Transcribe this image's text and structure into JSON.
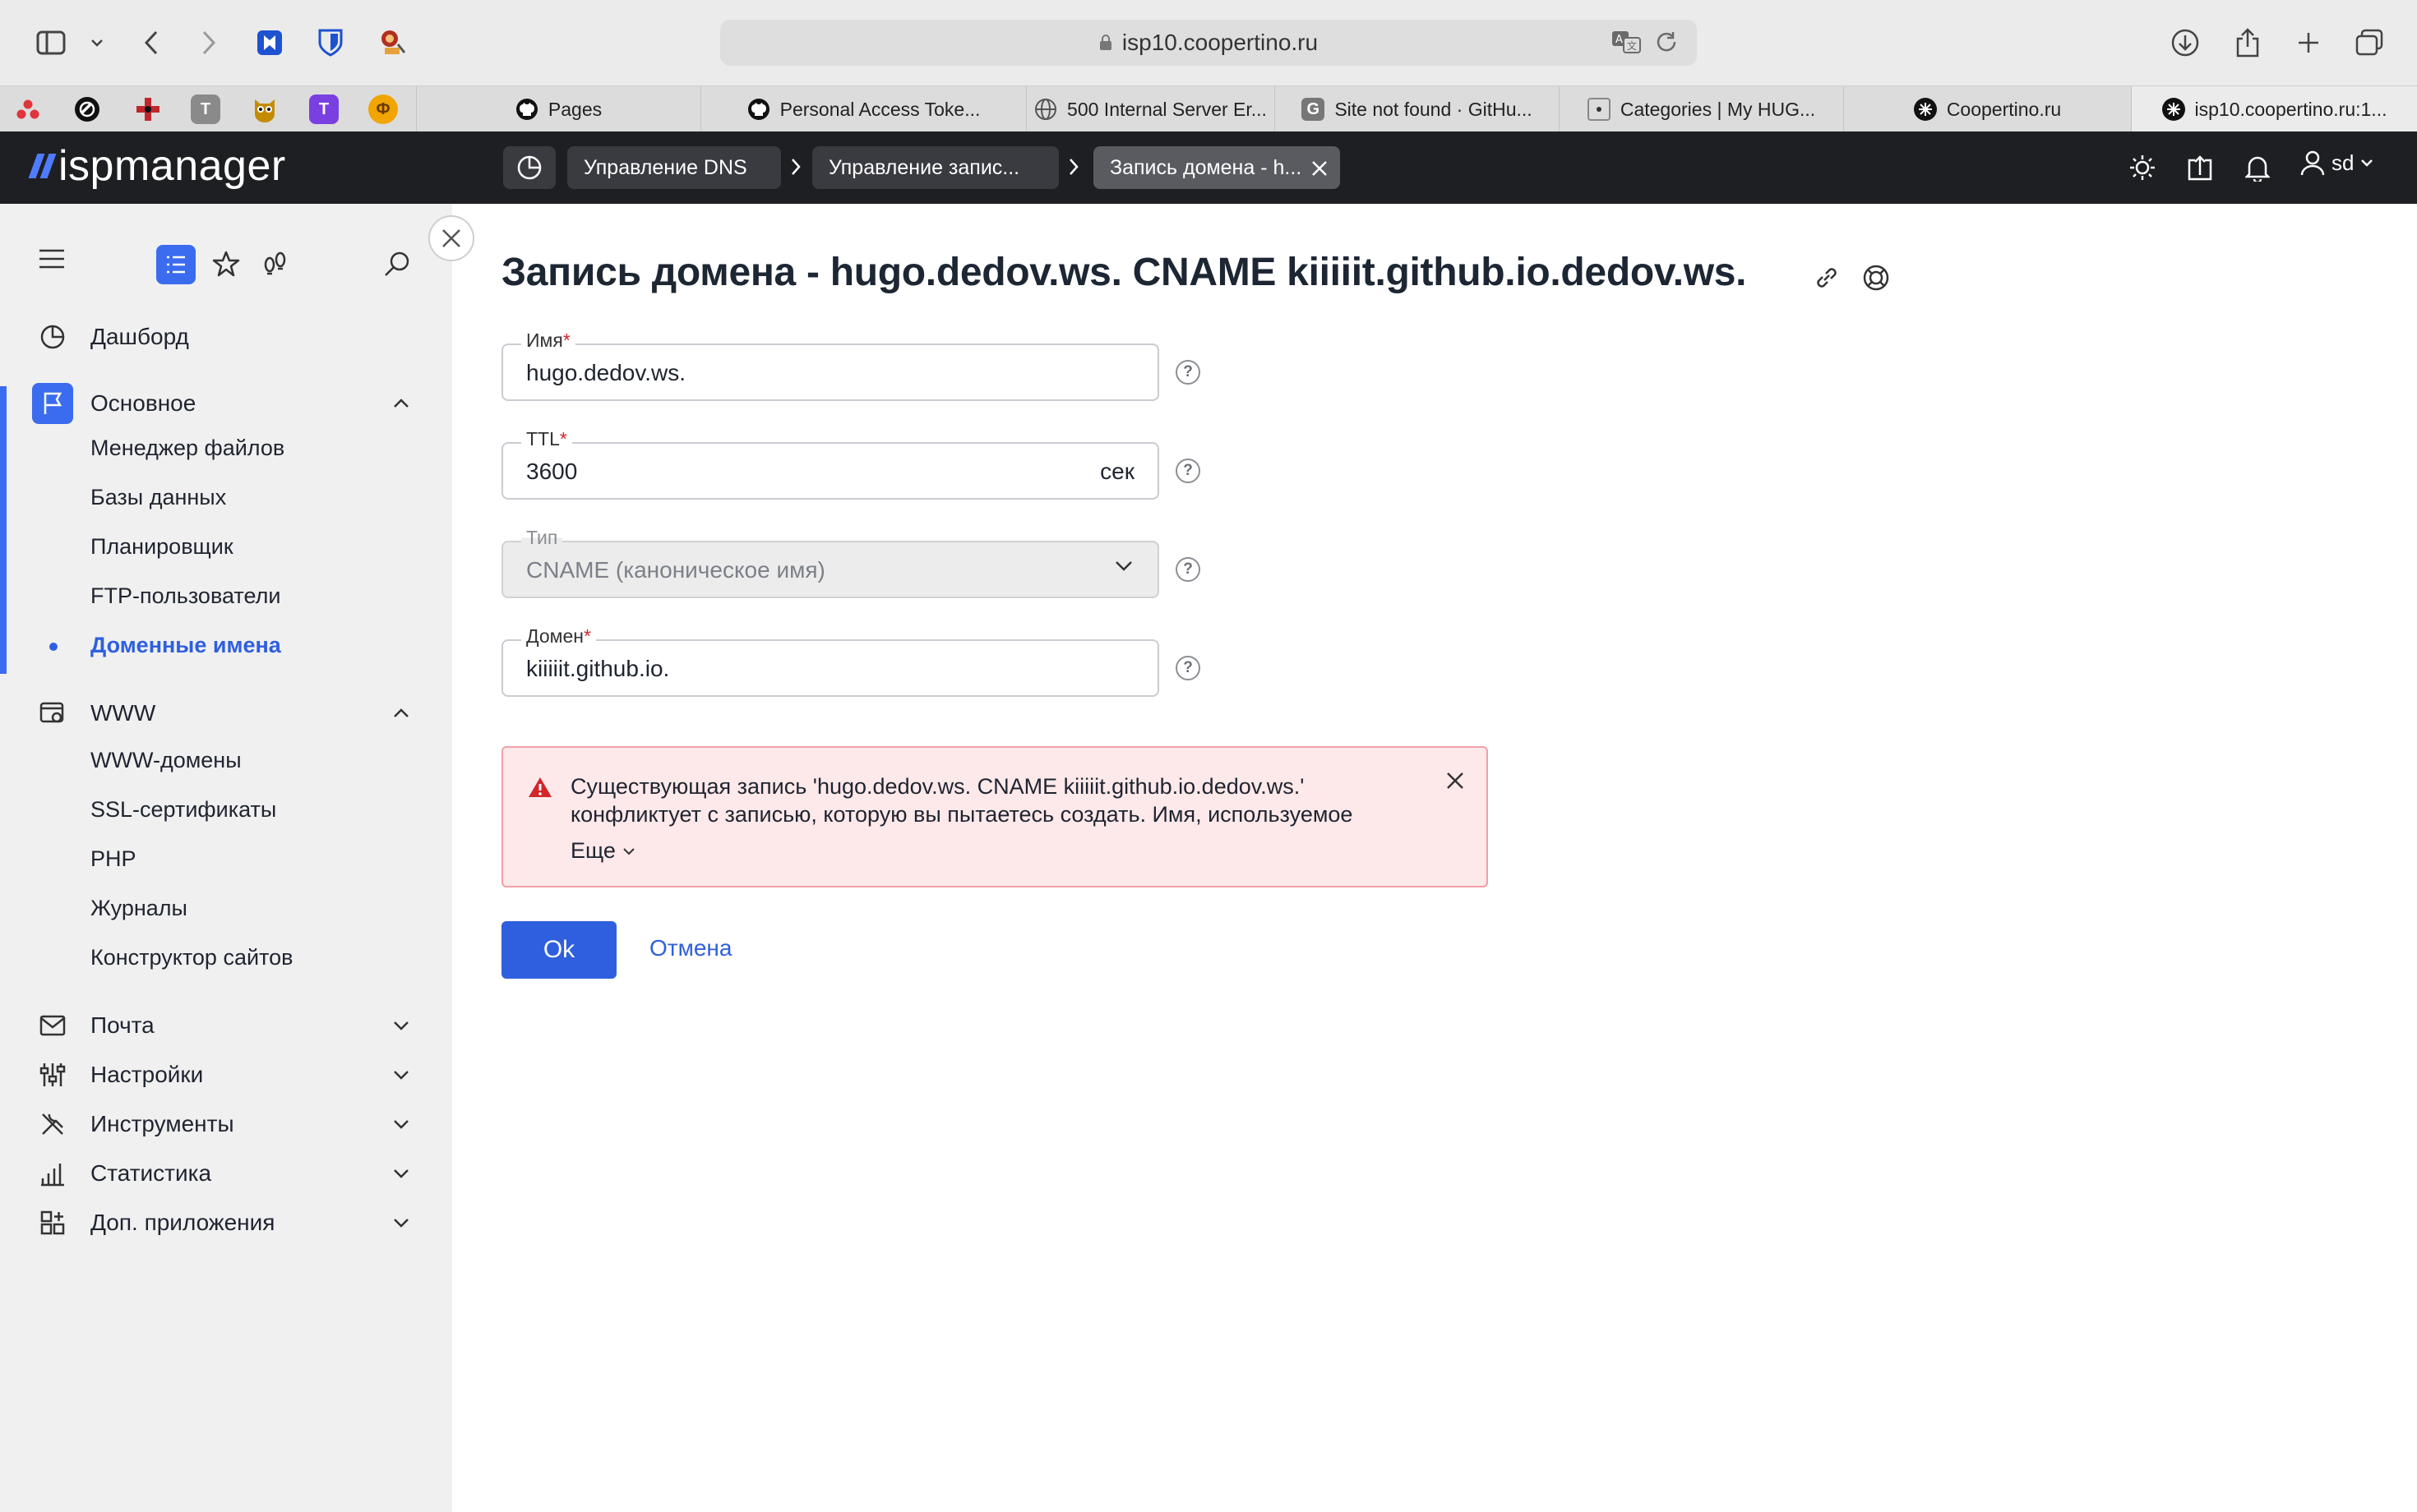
{
  "browser": {
    "url": "isp10.coopertino.ru",
    "pinned": [
      {
        "name": "red-dots",
        "color": "#e0353b",
        "glyph": ""
      },
      {
        "name": "black-circle",
        "color": "#111",
        "glyph": ""
      },
      {
        "name": "red-cross",
        "color": "#c0272d",
        "glyph": ""
      },
      {
        "name": "gray-t",
        "color": "#888",
        "glyph": "T"
      },
      {
        "name": "owl",
        "color": "#c58b00",
        "glyph": ""
      },
      {
        "name": "purple-t",
        "color": "#7a3fe0",
        "glyph": "T"
      },
      {
        "name": "orange-f",
        "color": "#f0a500",
        "glyph": "Ф"
      }
    ],
    "tabs": [
      {
        "label": "Pages",
        "fav": "github-icon"
      },
      {
        "label": "Personal Access Toke...",
        "fav": "github-icon"
      },
      {
        "label": "500 Internal Server Er...",
        "fav": "globe-icon"
      },
      {
        "label": "Site not found · GitHu...",
        "fav": "g-icon"
      },
      {
        "label": "Categories | My HUG...",
        "fav": "dot-icon"
      },
      {
        "label": "Coopertino.ru",
        "fav": "coop-icon"
      },
      {
        "label": "isp10.coopertino.ru:1...",
        "fav": "coop-icon"
      }
    ]
  },
  "app": {
    "logo": "ispmanager",
    "breadcrumbs": [
      "Управление DNS",
      "Управление запис...",
      "Запись домена - h..."
    ],
    "user": "sd"
  },
  "sidebar": {
    "dashboard": "Дашборд",
    "sections": [
      {
        "label": "Основное",
        "icon": "flag-icon",
        "expanded": true,
        "items": [
          "Менеджер файлов",
          "Базы данных",
          "Планировщик",
          "FTP-пользователи",
          "Доменные имена"
        ],
        "active_item": 4
      },
      {
        "label": "WWW",
        "icon": "www-settings-icon",
        "expanded": true,
        "items": [
          "WWW-домены",
          "SSL-сертификаты",
          "PHP",
          "Журналы",
          "Конструктор сайтов"
        ]
      },
      {
        "label": "Почта",
        "icon": "mail-icon",
        "expanded": false
      },
      {
        "label": "Настройки",
        "icon": "sliders-icon",
        "expanded": false
      },
      {
        "label": "Инструменты",
        "icon": "tools-icon",
        "expanded": false
      },
      {
        "label": "Статистика",
        "icon": "stats-icon",
        "expanded": false
      },
      {
        "label": "Доп. приложения",
        "icon": "apps-icon",
        "expanded": false
      }
    ]
  },
  "form": {
    "title": "Запись домена - hugo.dedov.ws. CNAME kiiiiit.github.io.dedov.ws.",
    "name": {
      "label": "Имя",
      "value": "hugo.dedov.ws."
    },
    "ttl": {
      "label": "TTL",
      "value": "3600",
      "suffix": "сек"
    },
    "type": {
      "label": "Тип",
      "value": "CNAME (каноническое имя)"
    },
    "domain": {
      "label": "Домен",
      "value": "kiiiiit.github.io."
    },
    "required_mark": "*",
    "help_glyph": "?",
    "alert": {
      "message": "Существующая запись 'hugo.dedov.ws. CNAME kiiiiit.github.io.dedov.ws.' конфликтует с записью, которую вы пытаетесь создать. Имя, используемое",
      "more": "Еще"
    },
    "ok": "Ok",
    "cancel": "Отмена"
  },
  "colors": {
    "accent": "#2f5fde",
    "header": "#1e1f23",
    "error_bg": "#fde8ea"
  }
}
